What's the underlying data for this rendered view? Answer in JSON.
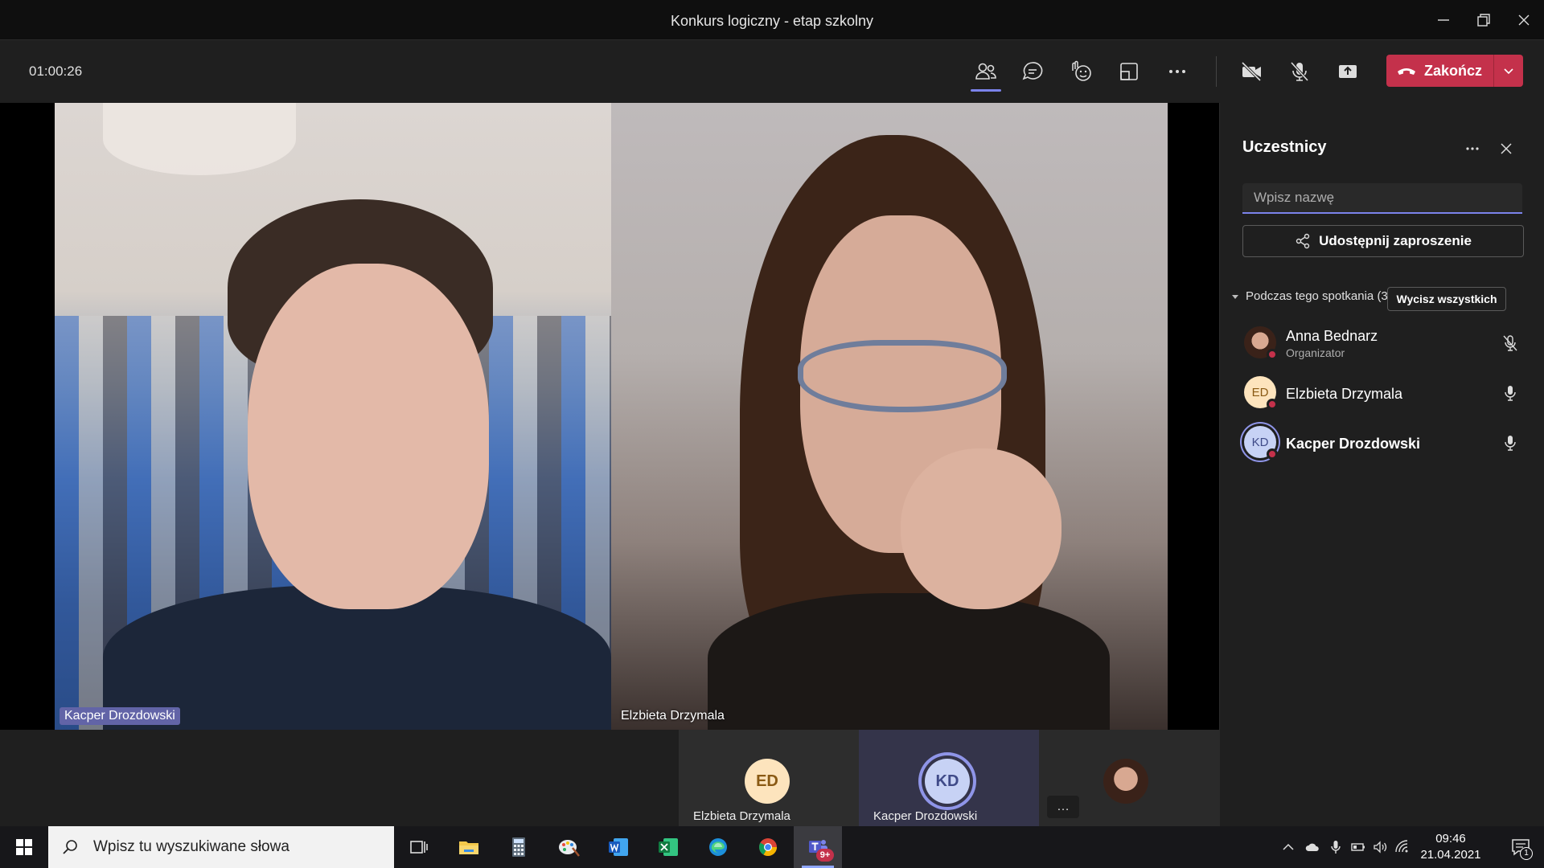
{
  "window": {
    "title": "Konkurs logiczny - etap szkolny"
  },
  "toolbar": {
    "timer": "01:00:26",
    "end_label": "Zakończ",
    "icons": [
      "participants-icon",
      "chat-icon",
      "reactions-icon",
      "rooms-icon",
      "more-icon",
      "camera-off-icon",
      "mic-off-icon",
      "share-icon"
    ]
  },
  "stage": {
    "tiles": [
      {
        "name": "Kacper Drozdowski"
      },
      {
        "name": "Elzbieta Drzymala"
      }
    ]
  },
  "strip": {
    "tiles": [
      {
        "initials": "ED",
        "name": "Elzbieta Drzymala"
      },
      {
        "initials": "KD",
        "name": "Kacper Drozdowski"
      }
    ],
    "more_label": "…"
  },
  "panel": {
    "title": "Uczestnicy",
    "search_placeholder": "Wpisz nazwę",
    "invite_label": "Udostępnij zaproszenie",
    "section_label": "Podczas tego spotkania (3)",
    "mute_all_label": "Wycisz wszystkich",
    "participants": [
      {
        "name": "Anna Bednarz",
        "role": "Organizator",
        "mic": "muted"
      },
      {
        "name": "Elzbieta Drzymala",
        "initials": "ED",
        "mic": "on"
      },
      {
        "name": "Kacper Drozdowski",
        "initials": "KD",
        "mic": "on"
      }
    ]
  },
  "taskbar": {
    "search_placeholder": "Wpisz tu wyszukiwane słowa",
    "time": "09:46",
    "date": "21.04.2021",
    "teams_badge": "9+",
    "notification_count": "1",
    "apps": [
      "task-view-icon",
      "file-explorer-icon",
      "calculator-icon",
      "paint-icon",
      "word-icon",
      "excel-icon",
      "edge-icon",
      "chrome-icon",
      "teams-icon"
    ]
  },
  "colors": {
    "accent": "#7b83eb",
    "end_call": "#c4314b",
    "background": "#1f1f1f"
  }
}
